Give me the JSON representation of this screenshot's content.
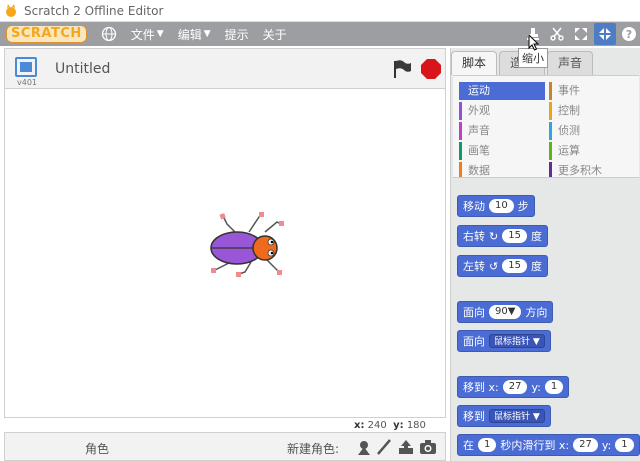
{
  "window": {
    "title": "Scratch 2 Offline Editor"
  },
  "menubar": {
    "logo": "SCRATCH",
    "items": [
      {
        "label": "文件",
        "caret": "▼"
      },
      {
        "label": "编辑",
        "caret": "▼"
      },
      {
        "label": "提示",
        "caret": ""
      },
      {
        "label": "关于",
        "caret": ""
      }
    ],
    "tooltip": "缩小"
  },
  "stage": {
    "version": "v401",
    "project_name": "Untitled",
    "coords": {
      "x_label": "x:",
      "x": "240",
      "y_label": "y:",
      "y": "180"
    }
  },
  "sprite_bar": {
    "sprites_label": "角色",
    "new_sprite_label": "新建角色:"
  },
  "scripts": {
    "tabs": [
      "脚本",
      "造型",
      "声音"
    ],
    "categories": [
      {
        "label": "运动",
        "color": "#4a6cd4",
        "selected": true
      },
      {
        "label": "事件",
        "color": "#c88330"
      },
      {
        "label": "外观",
        "color": "#8a55d7"
      },
      {
        "label": "控制",
        "color": "#e1a91a"
      },
      {
        "label": "声音",
        "color": "#bb42c3"
      },
      {
        "label": "侦测",
        "color": "#2ca5e2"
      },
      {
        "label": "画笔",
        "color": "#0e9a6c"
      },
      {
        "label": "运算",
        "color": "#5cb712"
      },
      {
        "label": "数据",
        "color": "#ee7d16"
      },
      {
        "label": "更多积木",
        "color": "#632d99"
      }
    ],
    "blocks": {
      "move": {
        "label": "移动",
        "value": "10",
        "suffix": "步"
      },
      "turn_right": {
        "label": "右转",
        "icon": "↻",
        "value": "15",
        "suffix": "度"
      },
      "turn_left": {
        "label": "左转",
        "icon": "↺",
        "value": "15",
        "suffix": "度"
      },
      "point_dir": {
        "label": "面向",
        "value": "90▼",
        "suffix": "方向"
      },
      "point_towards": {
        "label": "面向",
        "dropdown": "鼠标指针 ▼"
      },
      "goto_xy": {
        "label": "移到 x:",
        "x": "27",
        "y_label": "y:",
        "y": "1"
      },
      "goto": {
        "label": "移到",
        "dropdown": "鼠标指针 ▼"
      },
      "glide": {
        "label": "在",
        "secs": "1",
        "mid": "秒内滑行到 x:",
        "x": "27",
        "y_label": "y:",
        "y": "1"
      }
    }
  }
}
